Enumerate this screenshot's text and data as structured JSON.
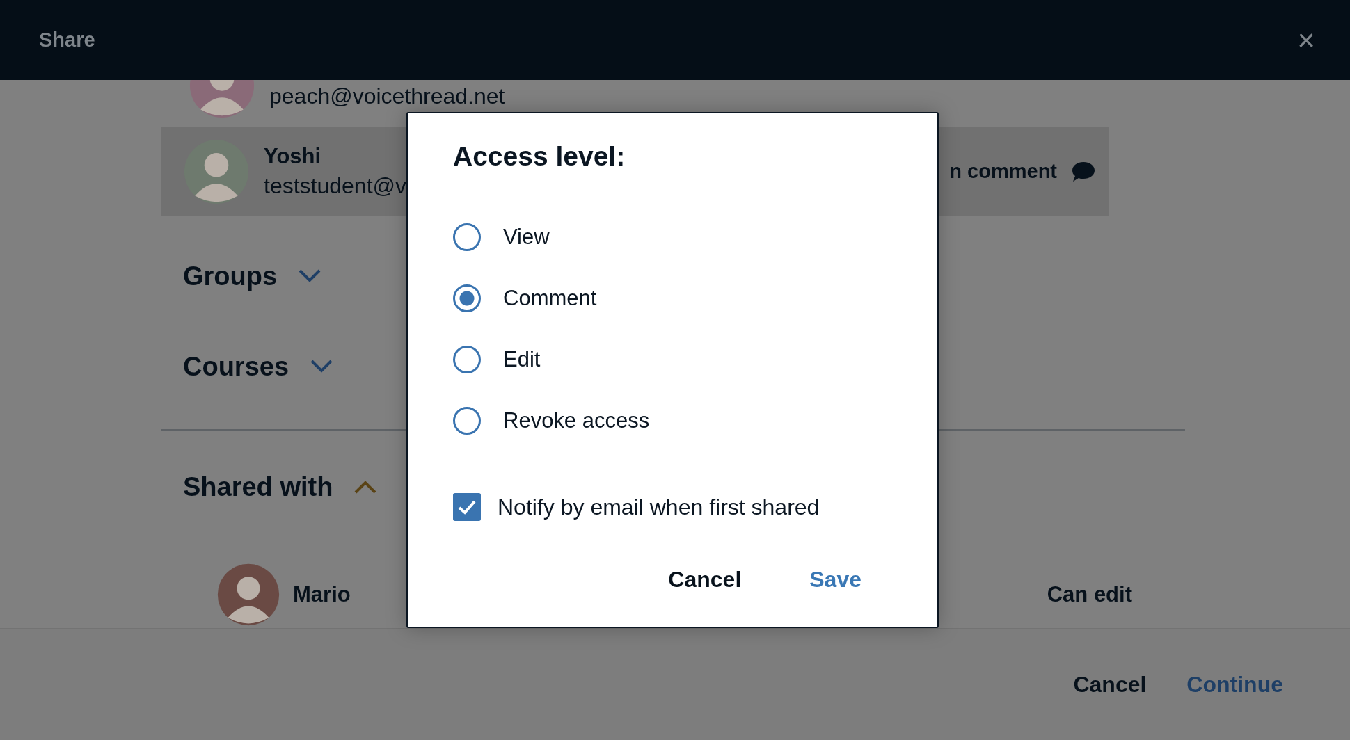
{
  "header": {
    "title": "Share",
    "close": "×"
  },
  "people": [
    {
      "email": "peach@voicethread.net"
    },
    {
      "name": "Yoshi",
      "email": "teststudent@v",
      "access": "n comment",
      "highlighted": true
    }
  ],
  "sections": [
    {
      "label": "Groups",
      "expanded": false
    },
    {
      "label": "Courses",
      "expanded": false
    },
    {
      "label": "Shared with",
      "expanded": true
    }
  ],
  "shared": [
    {
      "name": "Mario",
      "access": "Can edit"
    }
  ],
  "dialog": {
    "title": "Access level:",
    "options": [
      {
        "label": "View",
        "selected": false
      },
      {
        "label": "Comment",
        "selected": true
      },
      {
        "label": "Edit",
        "selected": false
      },
      {
        "label": "Revoke access",
        "selected": false
      }
    ],
    "notify": {
      "label": "Notify by email when first shared",
      "checked": true
    },
    "buttons": [
      {
        "label": "Cancel",
        "kind": "secondary"
      },
      {
        "label": "Save",
        "kind": "primary"
      }
    ]
  },
  "footer": {
    "buttons": [
      {
        "label": "Cancel",
        "kind": "secondary"
      },
      {
        "label": "Continue",
        "kind": "primary"
      }
    ]
  }
}
